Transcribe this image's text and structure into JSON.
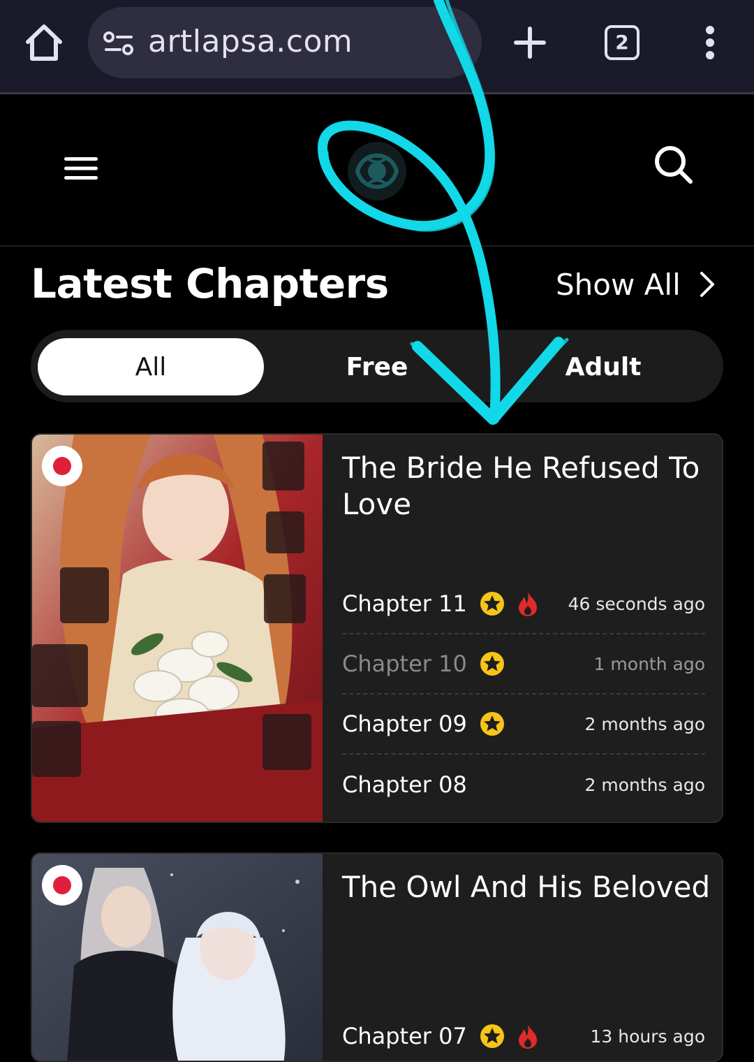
{
  "browser": {
    "url": "artlapsa.com",
    "tab_count": "2",
    "icons": [
      "home-icon",
      "site-info-icon",
      "plus-icon",
      "tabs-icon",
      "more-vert-icon"
    ]
  },
  "header": {
    "icons": [
      "hamburger-menu-icon",
      "site-logo",
      "search-icon"
    ]
  },
  "section": {
    "title": "Latest Chapters",
    "show_all": "Show All"
  },
  "filters": {
    "tabs": [
      {
        "label": "All",
        "active": true
      },
      {
        "label": "Free",
        "active": false
      },
      {
        "label": "Adult",
        "active": false
      }
    ]
  },
  "manga": [
    {
      "title": "The Bride He Refused To Love",
      "chapters": [
        {
          "name": "Chapter 11",
          "time": "46 seconds ago",
          "badges": [
            "star-icon",
            "fire-icon"
          ],
          "read": false
        },
        {
          "name": "Chapter 10",
          "time": "1 month ago",
          "badges": [
            "star-icon"
          ],
          "read": true
        },
        {
          "name": "Chapter 09",
          "time": "2 months ago",
          "badges": [
            "star-icon"
          ],
          "read": false
        },
        {
          "name": "Chapter 08",
          "time": "2 months ago",
          "badges": [],
          "read": false
        }
      ]
    },
    {
      "title": "The Owl And His Beloved",
      "chapters": [
        {
          "name": "Chapter 07",
          "time": "13 hours ago",
          "badges": [
            "star-icon",
            "fire-icon"
          ],
          "read": false
        }
      ]
    }
  ],
  "colors": {
    "browser_bar": "#1b1a2b",
    "url_pill": "#2f2d40",
    "card_bg": "#1e1e1e",
    "star": "#f5c518",
    "fire": "#e02a2a",
    "annotation": "#12d8e8",
    "flag_red": "#e0203a"
  }
}
